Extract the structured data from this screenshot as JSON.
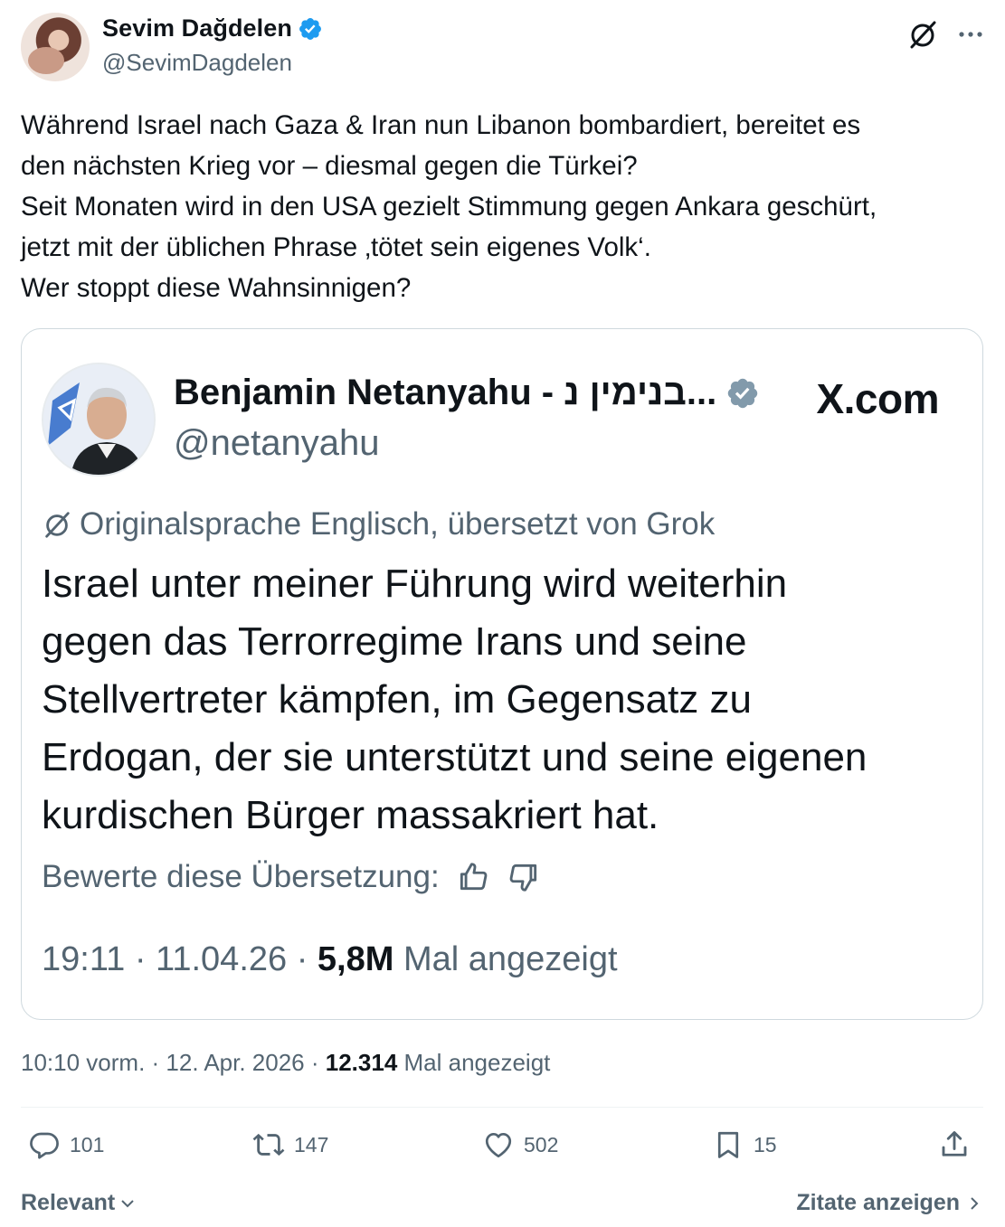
{
  "author": {
    "display_name": "Sevim Dağdelen",
    "handle": "@SevimDagdelen",
    "verified": true
  },
  "tweet": {
    "lines": [
      "Während Israel nach Gaza & Iran nun Libanon bombardiert, bereitet es",
      "den nächsten Krieg vor – diesmal gegen die Türkei?",
      "Seit Monaten wird in den USA gezielt Stimmung gegen Ankara geschürt,",
      "jetzt mit der üblichen Phrase ‚tötet sein eigenes Volk‘.",
      "Wer stoppt diese Wahnsinnigen?"
    ]
  },
  "quote": {
    "display_name": "Benjamin Netanyahu - בנימין נ...",
    "handle": "@netanyahu",
    "source": "X.com",
    "translated_label": "Originalsprache Englisch, übersetzt von Grok",
    "body_lines": [
      "Israel unter meiner Führung wird weiterhin",
      "gegen das Terrorregime Irans und seine",
      "Stellvertreter kämpfen, im Gegensatz zu",
      "Erdogan, der sie unterstützt und seine eigenen",
      "kurdischen Bürger massakriert hat."
    ],
    "rate_label": "Bewerte diese Übersetzung:",
    "time": "19:11 · 11.04.26 · ",
    "views": "5,8M",
    "views_label": " Mal angezeigt"
  },
  "meta": {
    "time": "10:10 vorm. · 12. Apr. 2026 · ",
    "views": "12.314",
    "views_label": " Mal angezeigt"
  },
  "actions": {
    "replies": "101",
    "reposts": "147",
    "likes": "502",
    "bookmarks": "15"
  },
  "bottom": {
    "sort_label": "Relevant",
    "quotes_link": "Zitate anzeigen"
  },
  "colors": {
    "verified": "#1d9bf0",
    "verified_gray": "#829aab",
    "text": "#0f1419",
    "secondary": "#536471",
    "border": "#cfd9de"
  }
}
